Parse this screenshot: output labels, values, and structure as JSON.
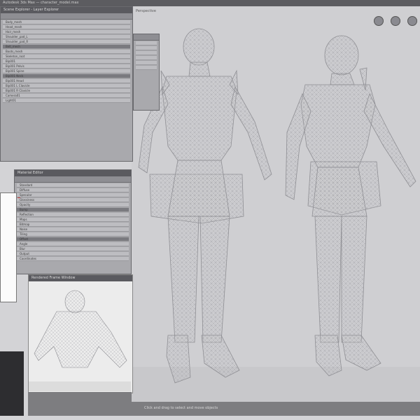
{
  "app": {
    "title": "Autodesk 3ds Max — character_model.max"
  },
  "colors": {
    "background": "#d3d3d6",
    "panel": "#a9a9ad",
    "titlebar": "#5a5a5f",
    "viewport": "#cfcfd2",
    "wire": "#8f8f94",
    "accent": "#c44444"
  },
  "icons": {
    "nav_orbit": "orbit-icon",
    "nav_pan": "pan-icon",
    "nav_zoom": "zoom-icon"
  },
  "windows": {
    "scene_explorer": {
      "title": "Scene Explorer - Layer Explorer",
      "rows": [
        "Body_mesh",
        "Head_mesh",
        "Hair_mesh",
        "Shoulder_pad_L",
        "Shoulder_pad_R",
        "Belt_mesh",
        "Boots_mesh",
        "Skeleton_root",
        "Bip001",
        "Bip001 Pelvis",
        "Bip001 Spine",
        "Bip001 Neck",
        "Bip001 Head",
        "Bip001 L Clavicle",
        "Bip001 R Clavicle",
        "Camera01",
        "Light01"
      ]
    },
    "properties": {
      "title": "Material Editor",
      "rows": [
        "Standard",
        "Diffuse",
        "Specular",
        "Glossiness",
        "Opacity",
        "Bump",
        "Reflection",
        "Maps",
        "Bitmap",
        "Noise",
        "Tiling",
        "Offset",
        "Angle",
        "Blur",
        "Output",
        "Coordinates"
      ]
    },
    "preview": {
      "title": "Rendered Frame Window"
    }
  },
  "viewport": {
    "label": "Perspective",
    "status": "Click and drag to select and move objects"
  }
}
